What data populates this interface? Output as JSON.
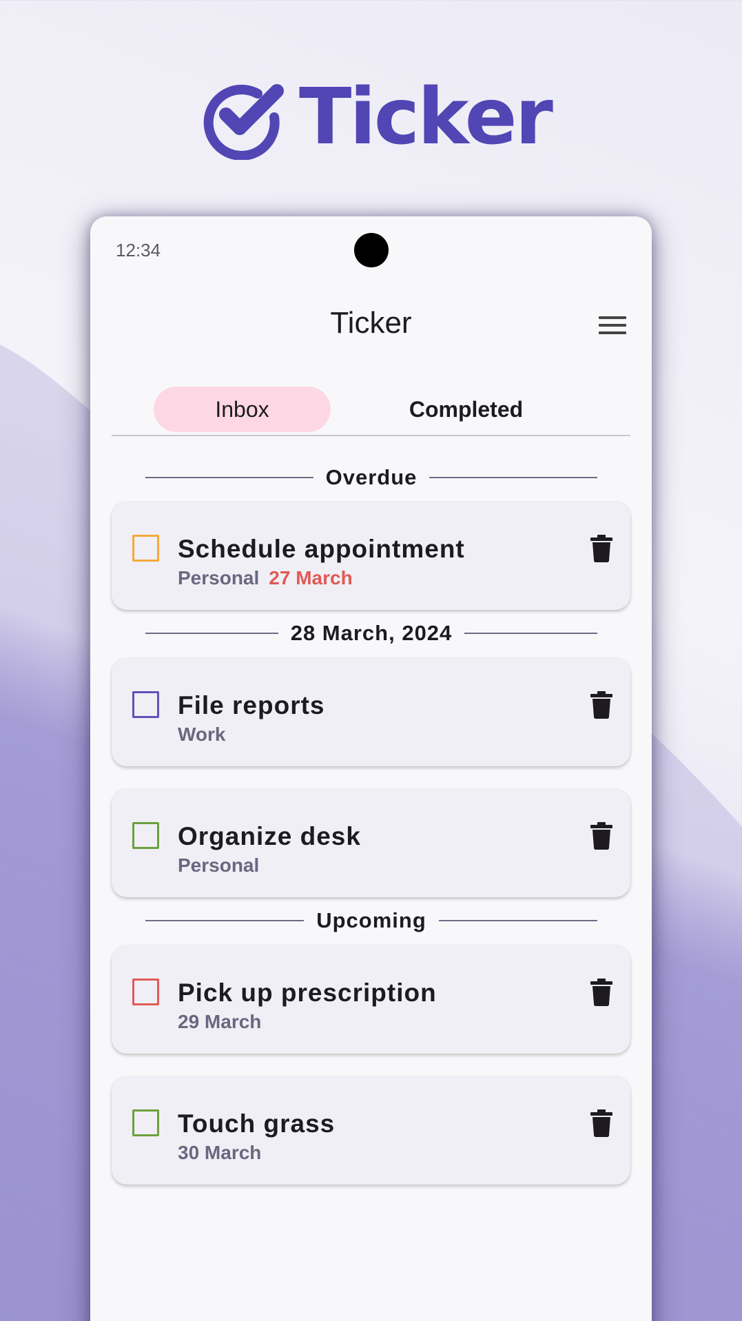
{
  "brand": {
    "name": "Ticker",
    "color": "#5146b3"
  },
  "status_bar": {
    "time": "12:34"
  },
  "app_bar": {
    "title": "Ticker",
    "menu_icon": "hamburger-menu-icon"
  },
  "tabs": [
    {
      "label": "Inbox",
      "active": true
    },
    {
      "label": "Completed",
      "active": false
    }
  ],
  "sections": [
    {
      "label": "Overdue",
      "tasks": [
        {
          "title": "Schedule appointment",
          "tag": "Personal",
          "due": "27 March",
          "checkbox_color": "#f5a93a",
          "checked": false
        }
      ]
    },
    {
      "label": "28 March, 2024",
      "tasks": [
        {
          "title": "File reports",
          "tag": "Work",
          "due": "",
          "checkbox_color": "#5e52b5",
          "checked": false
        },
        {
          "title": "Organize desk",
          "tag": "Personal",
          "due": "",
          "checkbox_color": "#6da03c",
          "checked": false
        }
      ]
    },
    {
      "label": "Upcoming",
      "tasks": [
        {
          "title": "Pick up prescription",
          "tag": "29 March",
          "due": "",
          "checkbox_color": "#e05a55",
          "checked": false
        },
        {
          "title": "Touch grass",
          "tag": "30 March",
          "due": "",
          "checkbox_color": "#6da03c",
          "checked": false
        }
      ]
    }
  ],
  "colors": {
    "overdue": "#e05a55",
    "tab_active_bg": "#fdd8e4",
    "accent": "#5146b3"
  }
}
